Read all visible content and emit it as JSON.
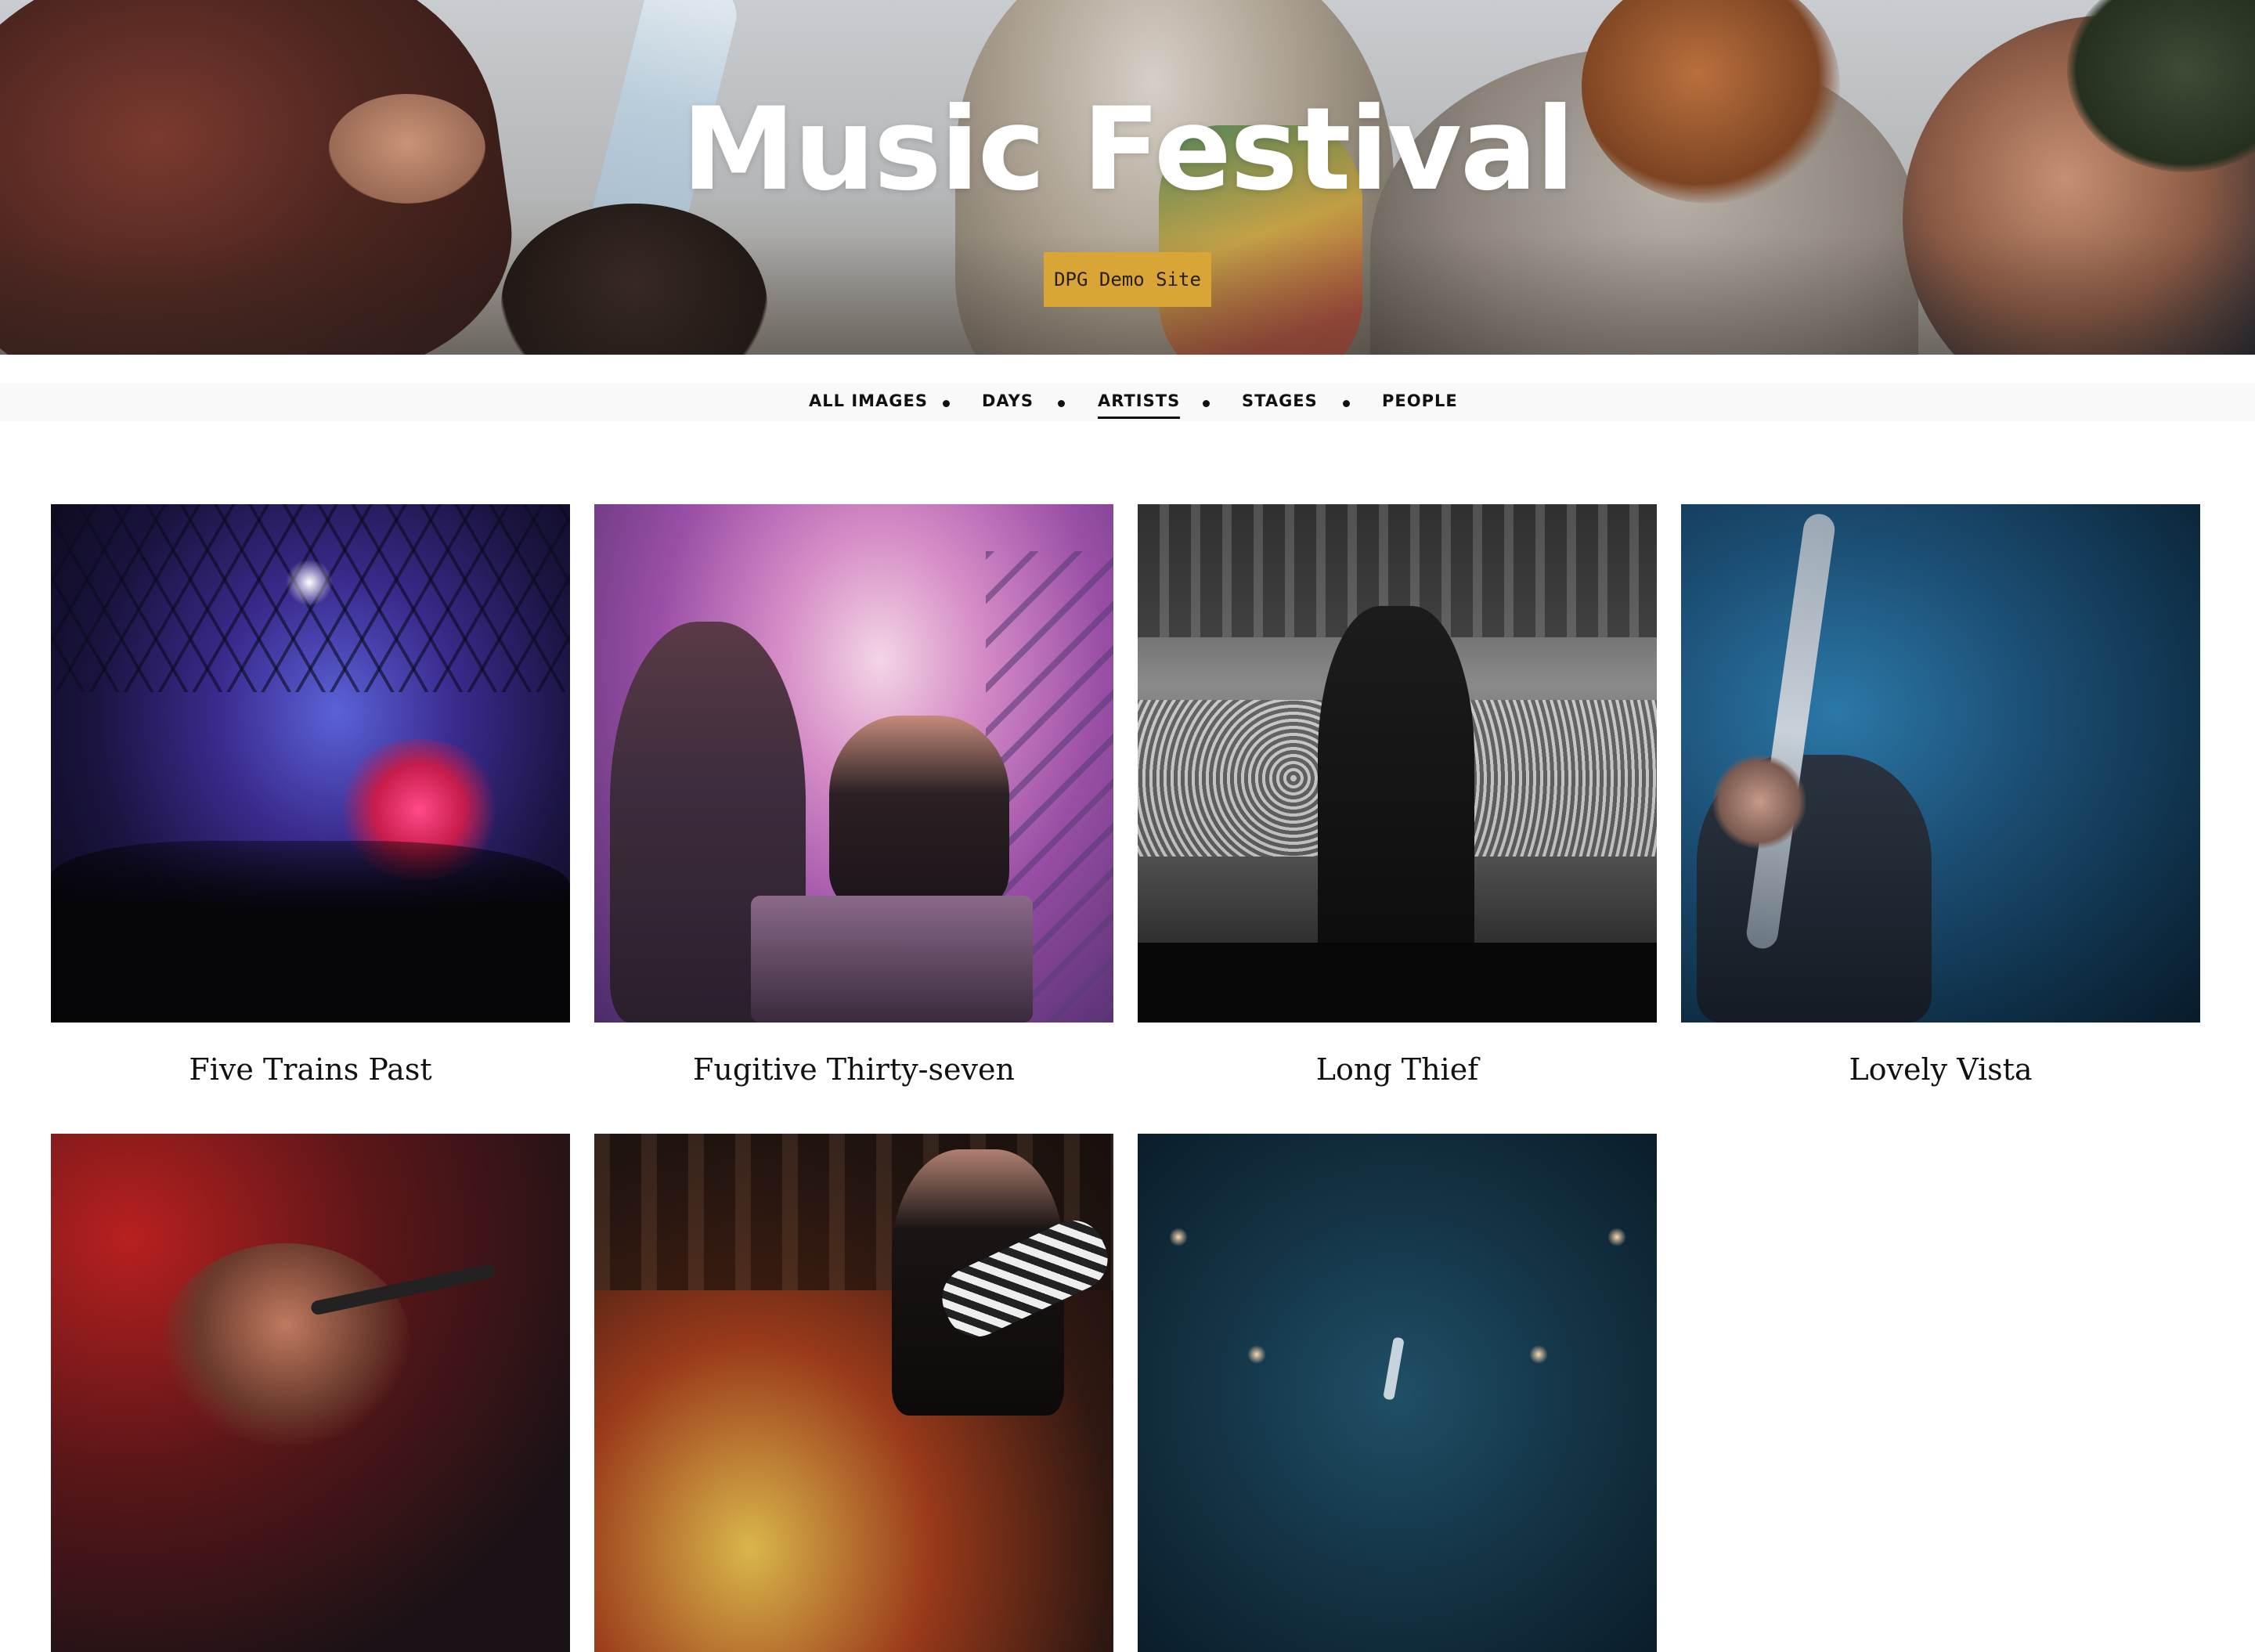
{
  "hero": {
    "title": "Music Festival",
    "badge": "DPG Demo Site"
  },
  "nav": {
    "items": [
      {
        "label": "ALL IMAGES",
        "active": false
      },
      {
        "label": "DAYS",
        "active": false
      },
      {
        "label": "ARTISTS",
        "active": true
      },
      {
        "label": "STAGES",
        "active": false
      },
      {
        "label": "PEOPLE",
        "active": false
      }
    ]
  },
  "gallery": {
    "items": [
      {
        "caption": "Five Trains Past"
      },
      {
        "caption": "Fugitive Thirty-seven"
      },
      {
        "caption": "Long Thief"
      },
      {
        "caption": "Lovely Vista"
      },
      {
        "caption": ""
      },
      {
        "caption": ""
      },
      {
        "caption": ""
      }
    ]
  },
  "colors": {
    "badge_background": "#d9a536",
    "nav_background": "#f9f9f9",
    "text": "#111111"
  }
}
